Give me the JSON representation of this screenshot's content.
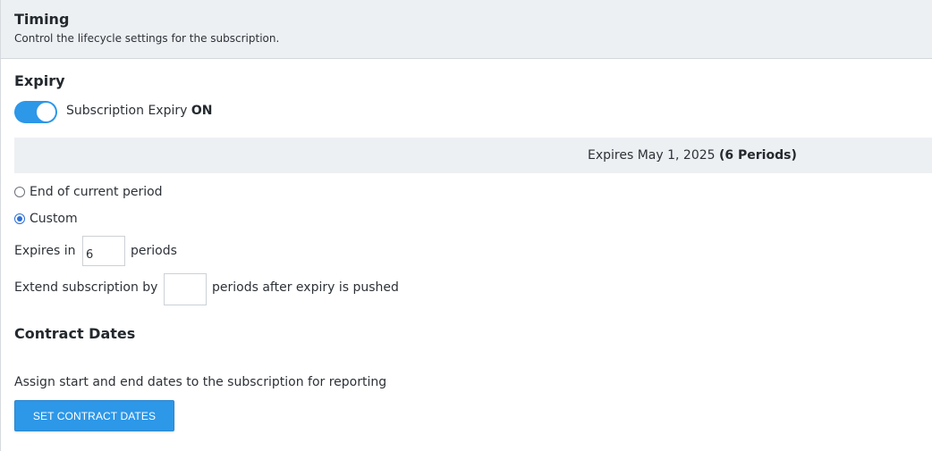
{
  "header": {
    "title": "Timing",
    "subtitle": "Control the lifecycle settings for the subscription."
  },
  "expiry": {
    "title": "Expiry",
    "toggle": {
      "label": "Subscription Expiry",
      "state": "ON",
      "on": true
    },
    "summary": {
      "text": "Expires May 1, 2025",
      "periods": "(6 Periods)"
    },
    "options": [
      {
        "label": "End of current period",
        "checked": false
      },
      {
        "label": "Custom",
        "checked": true
      }
    ],
    "expires_in": {
      "prefix": "Expires in",
      "value": "6",
      "suffix": "periods"
    },
    "extend": {
      "prefix": "Extend subscription by",
      "value": "",
      "suffix": "periods after expiry is pushed"
    }
  },
  "contract": {
    "title": "Contract Dates",
    "description": "Assign start and end dates to the subscription for reporting",
    "button_label": "SET CONTRACT DATES"
  },
  "colors": {
    "accent": "#2d97e8",
    "panel": "#edf0f3",
    "radio": "#2d6fd6"
  }
}
